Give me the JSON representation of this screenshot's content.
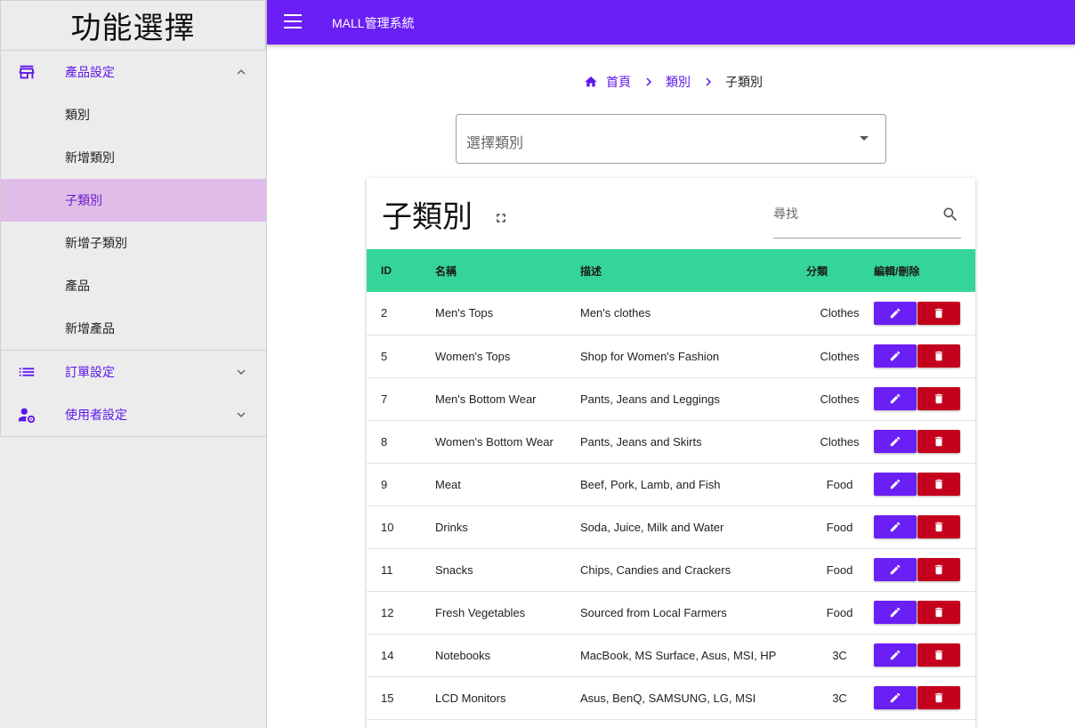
{
  "sidebar": {
    "title": "功能選擇",
    "groups": [
      {
        "label": "產品設定",
        "icon": "store-icon",
        "expanded": true,
        "items": [
          {
            "label": "類別"
          },
          {
            "label": "新增類別"
          },
          {
            "label": "子類別",
            "active": true
          },
          {
            "label": "新增子類別"
          },
          {
            "label": "產品"
          },
          {
            "label": "新增產品"
          }
        ]
      },
      {
        "label": "訂單設定",
        "icon": "list-icon",
        "expanded": false
      },
      {
        "label": "使用者設定",
        "icon": "user-settings-icon",
        "expanded": false
      }
    ]
  },
  "topbar": {
    "title": "MALL管理系統",
    "color": "#6a1ff5"
  },
  "breadcrumb": {
    "home": "首頁",
    "level1": "類別",
    "current": "子類別"
  },
  "select": {
    "placeholder": "選擇類別"
  },
  "card": {
    "title": "子類別",
    "search_placeholder": "尋找"
  },
  "table": {
    "header_color": "#35d59a",
    "columns": [
      "ID",
      "名稱",
      "描述",
      "分類",
      "編輯/刪除"
    ],
    "rows": [
      {
        "id": "2",
        "name": "Men's Tops",
        "desc": "Men's clothes",
        "cat": "Clothes"
      },
      {
        "id": "5",
        "name": "Women's Tops",
        "desc": "Shop for Women's Fashion",
        "cat": "Clothes"
      },
      {
        "id": "7",
        "name": "Men's Bottom Wear",
        "desc": "Pants, Jeans and Leggings",
        "cat": "Clothes"
      },
      {
        "id": "8",
        "name": "Women's Bottom Wear",
        "desc": "Pants, Jeans and Skirts",
        "cat": "Clothes"
      },
      {
        "id": "9",
        "name": "Meat",
        "desc": "Beef, Pork, Lamb, and Fish",
        "cat": "Food"
      },
      {
        "id": "10",
        "name": "Drinks",
        "desc": "Soda, Juice, Milk and Water",
        "cat": "Food"
      },
      {
        "id": "11",
        "name": "Snacks",
        "desc": "Chips, Candies and Crackers",
        "cat": "Food"
      },
      {
        "id": "12",
        "name": "Fresh Vegetables",
        "desc": "Sourced from Local Farmers",
        "cat": "Food"
      },
      {
        "id": "14",
        "name": "Notebooks",
        "desc": "MacBook, MS Surface, Asus, MSI, HP",
        "cat": "3C"
      },
      {
        "id": "15",
        "name": "LCD Monitors",
        "desc": "Asus, BenQ, SAMSUNG, LG, MSI",
        "cat": "3C"
      }
    ]
  },
  "colors": {
    "accent": "#5e17eb",
    "edit_button": "#6a1ff5",
    "delete_button": "#c4001d",
    "active_item_bg": "#dfbde8"
  }
}
